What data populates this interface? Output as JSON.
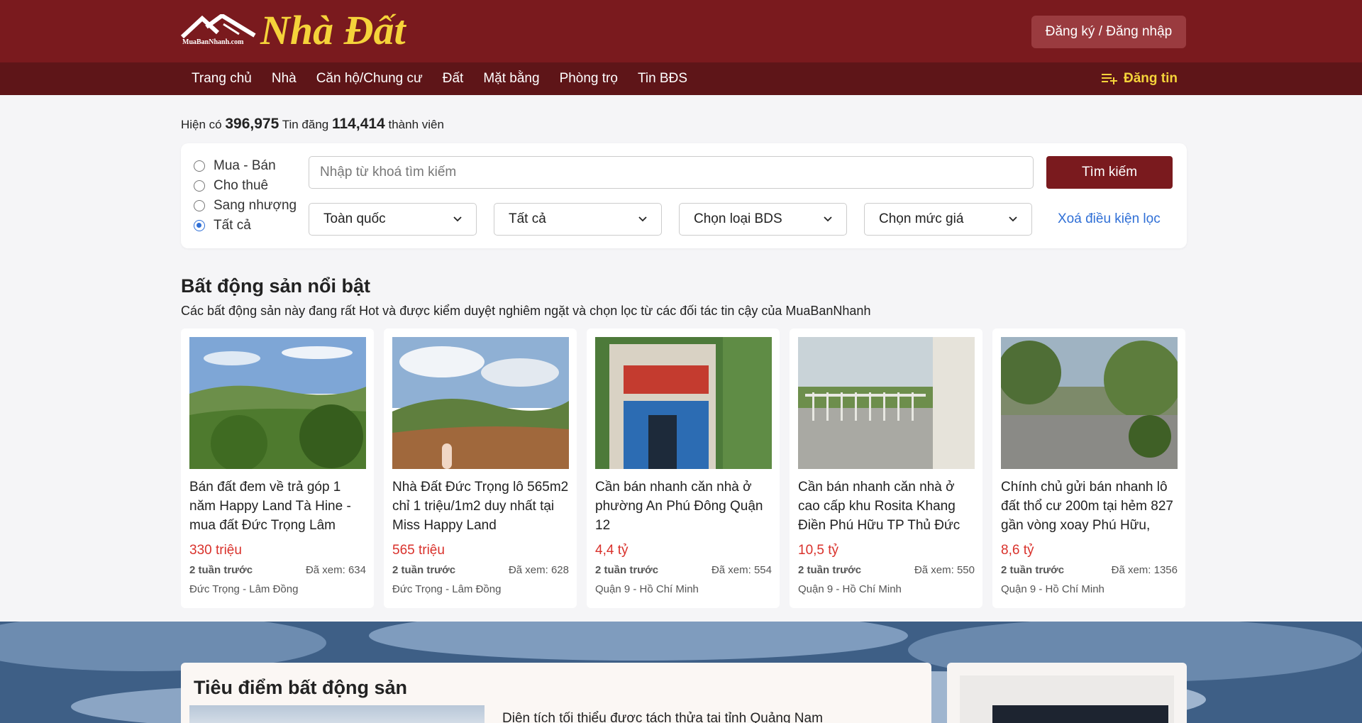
{
  "header": {
    "logo_small": "MuaBanNhanh.com",
    "logo_big": "Nhà Đất",
    "login_label": "Đăng ký / Đăng nhập"
  },
  "nav": {
    "items": [
      {
        "label": "Trang chủ"
      },
      {
        "label": "Nhà"
      },
      {
        "label": "Căn hộ/Chung cư"
      },
      {
        "label": "Đất"
      },
      {
        "label": "Mặt bằng"
      },
      {
        "label": "Phòng trọ"
      },
      {
        "label": "Tin BĐS"
      }
    ],
    "post_label": "Đăng tin"
  },
  "stats": {
    "prefix": "Hiện có",
    "listings": "396,975",
    "listings_label": "Tin đăng",
    "members": "114,414",
    "members_label": "thành viên"
  },
  "search": {
    "radios": [
      {
        "label": "Mua - Bán",
        "checked": false
      },
      {
        "label": "Cho thuê",
        "checked": false
      },
      {
        "label": "Sang nhượng",
        "checked": false
      },
      {
        "label": "Tất cả",
        "checked": true
      }
    ],
    "placeholder": "Nhập từ khoá tìm kiếm",
    "button_label": "Tìm kiếm",
    "selects": [
      {
        "value": "Toàn quốc"
      },
      {
        "value": "Tất cả"
      },
      {
        "value": "Chọn loại BDS"
      },
      {
        "value": "Chọn mức giá"
      }
    ],
    "clear_label": "Xoá điều kiện lọc"
  },
  "featured": {
    "title": "Bất động sản nổi bật",
    "subtitle": "Các bất động sản này đang rất Hot và được kiểm duyệt nghiêm ngặt và chọn lọc từ các đối tác tin cậy của MuaBanNhanh",
    "cards": [
      {
        "title": "Bán đất đem về trả góp 1 năm Happy Land Tà Hine - mua đất Đức Trọng Lâm",
        "price": "330 triệu",
        "time": "2 tuần trước",
        "views": "Đã xem: 634",
        "location": "Đức Trọng - Lâm Đồng"
      },
      {
        "title": "Nhà Đất Đức Trọng lô 565m2 chỉ 1 triệu/1m2 duy nhất tại Miss Happy Land",
        "price": "565 triệu",
        "time": "2 tuần trước",
        "views": "Đã xem: 628",
        "location": "Đức Trọng - Lâm Đồng"
      },
      {
        "title": "Cần bán nhanh căn nhà ở phường An Phú Đông Quận 12",
        "price": "4,4 tỷ",
        "time": "2 tuần trước",
        "views": "Đã xem: 554",
        "location": "Quận 9 - Hồ Chí Minh"
      },
      {
        "title": "Cần bán nhanh căn nhà ở cao cấp khu Rosita Khang Điền Phú Hữu TP Thủ Đức",
        "price": "10,5 tỷ",
        "time": "2 tuần trước",
        "views": "Đã xem: 550",
        "location": "Quận 9 - Hồ Chí Minh"
      },
      {
        "title": "Chính chủ gửi bán nhanh lô đất thổ cư 200m tại hẻm 827 gần vòng xoay Phú Hữu,",
        "price": "8,6 tỷ",
        "time": "2 tuần trước",
        "views": "Đã xem: 1356",
        "location": "Quận 9 - Hồ Chí Minh"
      }
    ]
  },
  "focus": {
    "title": "Tiêu điểm bất động sản",
    "article_title": "Diện tích tối thiểu được tách thửa tại tỉnh Quảng Nam"
  },
  "colors": {
    "brand": "#7a1a1e",
    "nav": "#5e1518",
    "accent_yellow": "#f5d33a",
    "price_red": "#d9312b",
    "link_blue": "#2f6fd6"
  }
}
